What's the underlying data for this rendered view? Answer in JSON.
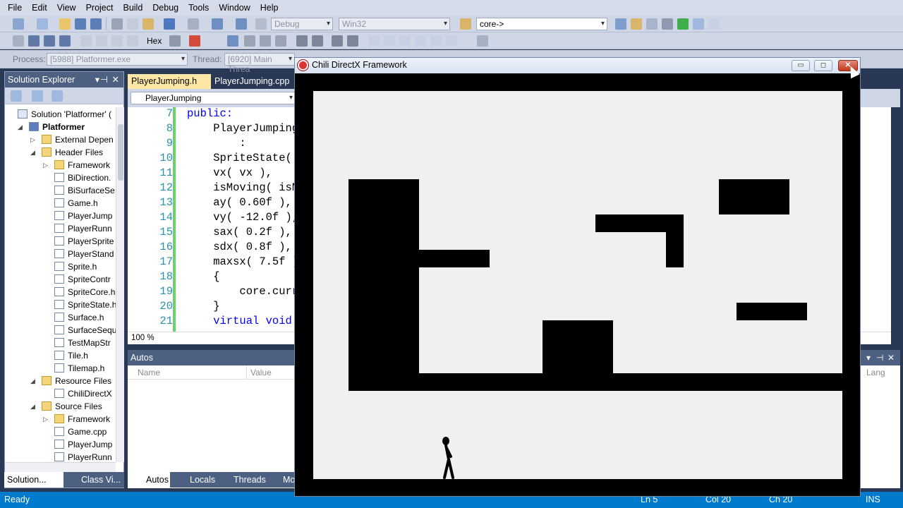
{
  "menu": [
    "File",
    "Edit",
    "View",
    "Project",
    "Build",
    "Debug",
    "Tools",
    "Window",
    "Help"
  ],
  "toolbar": {
    "config": "Debug",
    "platform": "Win32",
    "find": "core->",
    "hex": "Hex"
  },
  "debug_location": {
    "process_label": "Process:",
    "process_value": "[5988] Platformer.exe",
    "thread_label": "Thread:",
    "thread_value": "[6920] Main Threa"
  },
  "solution_explorer": {
    "title": "Solution Explorer",
    "items": [
      {
        "label": "Solution 'Platformer' (",
        "kind": "solution"
      },
      {
        "label": "Platformer",
        "kind": "project"
      },
      {
        "label": "External Depen",
        "kind": "folder"
      },
      {
        "label": "Header Files",
        "kind": "folder"
      },
      {
        "label": "Framework",
        "kind": "folder"
      },
      {
        "label": "BiDirection.",
        "kind": "file",
        "ext": "h"
      },
      {
        "label": "BiSurfaceSe",
        "kind": "file",
        "ext": "h"
      },
      {
        "label": "Game.h",
        "kind": "file",
        "ext": "h"
      },
      {
        "label": "PlayerJump",
        "kind": "file",
        "ext": "h"
      },
      {
        "label": "PlayerRunn",
        "kind": "file",
        "ext": "h"
      },
      {
        "label": "PlayerSprite",
        "kind": "file",
        "ext": "h"
      },
      {
        "label": "PlayerStand",
        "kind": "file",
        "ext": "h"
      },
      {
        "label": "Sprite.h",
        "kind": "file",
        "ext": "h"
      },
      {
        "label": "SpriteContr",
        "kind": "file",
        "ext": "h"
      },
      {
        "label": "SpriteCore.h",
        "kind": "file",
        "ext": "h"
      },
      {
        "label": "SpriteState.h",
        "kind": "file",
        "ext": "h"
      },
      {
        "label": "Surface.h",
        "kind": "file",
        "ext": "h"
      },
      {
        "label": "SurfaceSequ",
        "kind": "file",
        "ext": "h"
      },
      {
        "label": "TestMapStr",
        "kind": "file",
        "ext": "h"
      },
      {
        "label": "Tile.h",
        "kind": "file",
        "ext": "h"
      },
      {
        "label": "Tilemap.h",
        "kind": "file",
        "ext": "h"
      },
      {
        "label": "Resource Files",
        "kind": "folder"
      },
      {
        "label": "ChiliDirectX",
        "kind": "file",
        "ext": "rc"
      },
      {
        "label": "Source Files",
        "kind": "folder"
      },
      {
        "label": "Framework",
        "kind": "folder"
      },
      {
        "label": "Game.cpp",
        "kind": "file",
        "ext": "cpp"
      },
      {
        "label": "PlayerJump",
        "kind": "file",
        "ext": "cpp"
      },
      {
        "label": "PlayerRunn",
        "kind": "file",
        "ext": "cpp"
      }
    ],
    "tabs": [
      "Solution...",
      "Class Vi..."
    ]
  },
  "editor": {
    "tabs": [
      "PlayerJumping.h",
      "PlayerJumping.cpp"
    ],
    "nav": "PlayerJumping",
    "zoom": "100 %",
    "lines": [
      {
        "n": "7",
        "text": "public:"
      },
      {
        "n": "8",
        "text": "    PlayerJumping"
      },
      {
        "n": "9",
        "text": "        :"
      },
      {
        "n": "10",
        "text": "    SpriteState("
      },
      {
        "n": "11",
        "text": "    vx( vx ),"
      },
      {
        "n": "12",
        "text": "    isMoving( isM"
      },
      {
        "n": "13",
        "text": "    ay( 0.60f ),"
      },
      {
        "n": "14",
        "text": "    vy( -12.0f ),"
      },
      {
        "n": "15",
        "text": "    sax( 0.2f ),"
      },
      {
        "n": "16",
        "text": "    sdx( 0.8f ),"
      },
      {
        "n": "17",
        "text": "    maxsx( 7.5f )"
      },
      {
        "n": "18",
        "text": "    {"
      },
      {
        "n": "19",
        "text": "        core.curr"
      },
      {
        "n": "20",
        "text": "    }"
      },
      {
        "n": "21",
        "text": "    virtual void"
      }
    ]
  },
  "autos": {
    "title": "Autos",
    "col_name": "Name",
    "col_value": "Value",
    "tabs": [
      "Autos",
      "Locals",
      "Threads",
      "Mo"
    ]
  },
  "right_pane": {
    "col": "Lang"
  },
  "game_window": {
    "title": "Chili DirectX Framework",
    "minimize": "▭",
    "maximize": "◻",
    "close": "✕"
  },
  "status": {
    "ready": "Ready",
    "ln": "Ln 5",
    "col": "Col 20",
    "ch": "Ch 20",
    "ins": "INS"
  }
}
